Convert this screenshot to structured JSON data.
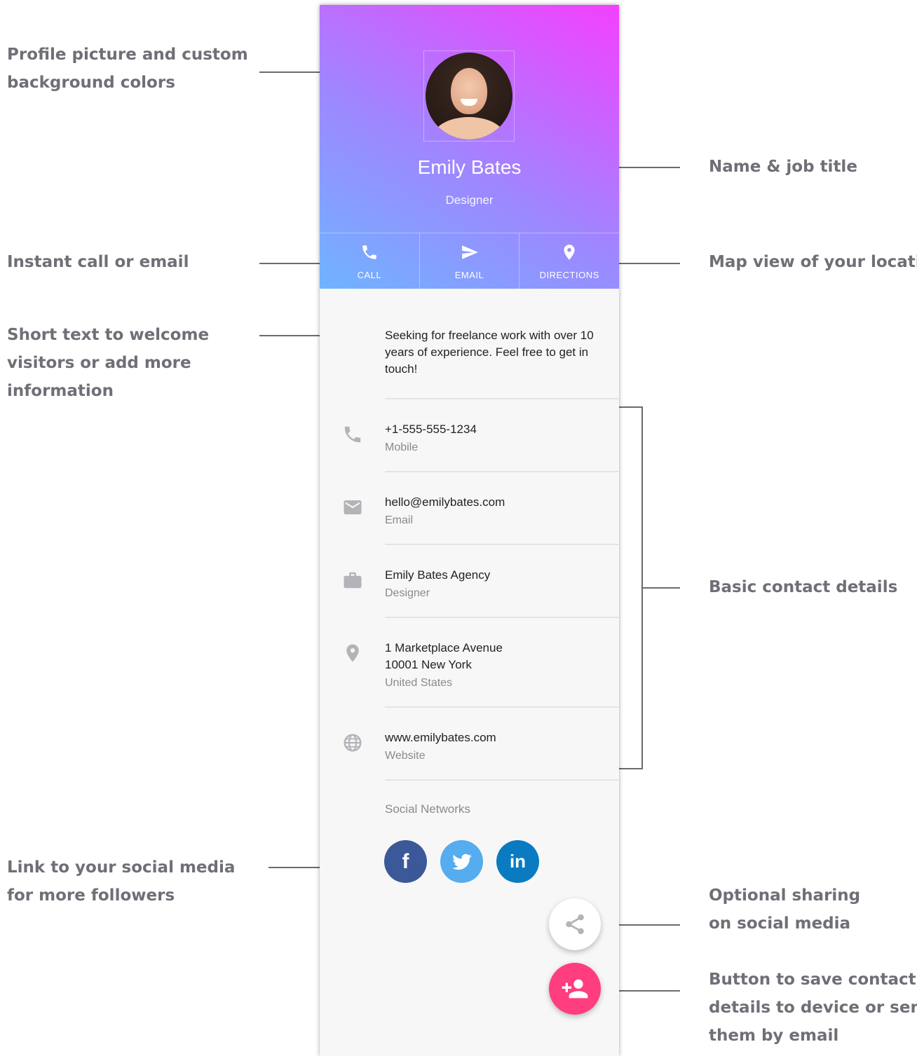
{
  "annotations": {
    "profile": [
      "Profile picture and custom",
      "background colors"
    ],
    "instant": [
      "Instant call or email"
    ],
    "short_text": [
      "Short text to welcome",
      "visitors or add more",
      "information"
    ],
    "social_link": [
      "Link to your social media",
      "for more followers"
    ],
    "name_title": [
      "Name & job title"
    ],
    "map_view": [
      "Map view of your location"
    ],
    "basic": [
      "Basic contact details"
    ],
    "sharing": [
      "Optional sharing",
      "on social media"
    ],
    "save": [
      "Button to save contact",
      "details to device or send",
      "them by email"
    ]
  },
  "profile": {
    "name": "Emily Bates",
    "title": "Designer",
    "colors": {
      "gradient_start": "#6fb4ff",
      "gradient_mid": "#9f86ff",
      "gradient_end": "#f440ff"
    }
  },
  "actions": [
    {
      "label": "CALL",
      "icon": "phone-icon"
    },
    {
      "label": "EMAIL",
      "icon": "send-icon"
    },
    {
      "label": "DIRECTIONS",
      "icon": "location-pin-icon"
    }
  ],
  "bio": "Seeking for freelance work with over 10 years of experience. Feel free to get in touch!",
  "contacts": [
    {
      "icon": "phone-icon",
      "lines": [
        "+1-555-555-1234"
      ],
      "sub": "Mobile"
    },
    {
      "icon": "mail-icon",
      "lines": [
        "hello@emilybates.com"
      ],
      "sub": "Email"
    },
    {
      "icon": "briefcase-icon",
      "lines": [
        "Emily Bates Agency"
      ],
      "sub": "Designer"
    },
    {
      "icon": "location-pin-icon",
      "lines": [
        "1 Marketplace Avenue",
        "10001 New York"
      ],
      "sub": "United States"
    },
    {
      "icon": "globe-icon",
      "lines": [
        "www.emilybates.com"
      ],
      "sub": "Website"
    }
  ],
  "social": {
    "title": "Social Networks",
    "networks": [
      {
        "name": "facebook",
        "glyph": "f",
        "color": "#3b5998"
      },
      {
        "name": "twitter",
        "glyph": "",
        "color": "#55acee"
      },
      {
        "name": "linkedin",
        "glyph": "in",
        "color": "#0a7bc1"
      }
    ]
  },
  "fabs": {
    "share": {
      "icon": "share-icon",
      "color": "#ffffff"
    },
    "save": {
      "icon": "add-person-icon",
      "color": "#ff3d7f"
    }
  }
}
